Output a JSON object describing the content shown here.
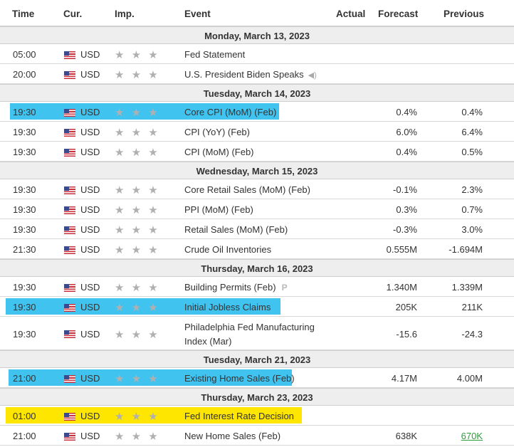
{
  "columns": {
    "time": "Time",
    "currency": "Cur.",
    "importance": "Imp.",
    "event": "Event",
    "actual": "Actual",
    "forecast": "Forecast",
    "previous": "Previous"
  },
  "colors": {
    "highlight_blue": "#41c3f0",
    "highlight_yellow": "#ffe600",
    "previous_better": "#2e9c3a"
  },
  "days": [
    {
      "label": "Monday, March 13, 2023",
      "events": [
        {
          "time": "05:00",
          "currency": "USD",
          "stars": "★ ★ ★",
          "event": "Fed Statement",
          "forecast": "",
          "previous": ""
        },
        {
          "time": "20:00",
          "currency": "USD",
          "stars": "★ ★ ★",
          "event": "U.S. President Biden Speaks",
          "forecast": "",
          "previous": "",
          "icon": "speaker-icon"
        }
      ]
    },
    {
      "label": "Tuesday, March 14, 2023",
      "events": [
        {
          "time": "19:30",
          "currency": "USD",
          "stars": "★ ★ ★",
          "event": "Core CPI (MoM) (Feb)",
          "forecast": "0.4%",
          "previous": "0.4%",
          "highlight": "blue"
        },
        {
          "time": "19:30",
          "currency": "USD",
          "stars": "★ ★ ★",
          "event": "CPI (YoY) (Feb)",
          "forecast": "6.0%",
          "previous": "6.4%"
        },
        {
          "time": "19:30",
          "currency": "USD",
          "stars": "★ ★ ★",
          "event": "CPI (MoM) (Feb)",
          "forecast": "0.4%",
          "previous": "0.5%"
        }
      ]
    },
    {
      "label": "Wednesday, March 15, 2023",
      "events": [
        {
          "time": "19:30",
          "currency": "USD",
          "stars": "★ ★ ★",
          "event": "Core Retail Sales (MoM) (Feb)",
          "forecast": "-0.1%",
          "previous": "2.3%"
        },
        {
          "time": "19:30",
          "currency": "USD",
          "stars": "★ ★ ★",
          "event": "PPI (MoM) (Feb)",
          "forecast": "0.3%",
          "previous": "0.7%"
        },
        {
          "time": "19:30",
          "currency": "USD",
          "stars": "★ ★ ★",
          "event": "Retail Sales (MoM) (Feb)",
          "forecast": "-0.3%",
          "previous": "3.0%"
        },
        {
          "time": "21:30",
          "currency": "USD",
          "stars": "★ ★ ★",
          "event": "Crude Oil Inventories",
          "forecast": "0.555M",
          "previous": "-1.694M"
        }
      ]
    },
    {
      "label": "Thursday, March 16, 2023",
      "events": [
        {
          "time": "19:30",
          "currency": "USD",
          "stars": "★ ★ ★",
          "event": "Building Permits (Feb)",
          "forecast": "1.340M",
          "previous": "1.339M",
          "badge": "P"
        },
        {
          "time": "19:30",
          "currency": "USD",
          "stars": "★ ★ ★",
          "event": "Initial Jobless Claims",
          "forecast": "205K",
          "previous": "211K",
          "highlight": "blue"
        },
        {
          "time": "19:30",
          "currency": "USD",
          "stars": "★ ★ ★",
          "event": "Philadelphia Fed Manufacturing Index (Mar)",
          "forecast": "-15.6",
          "previous": "-24.3",
          "tall": true
        }
      ]
    },
    {
      "label": "Tuesday, March 21, 2023",
      "events": [
        {
          "time": "21:00",
          "currency": "USD",
          "stars": "★ ★ ★",
          "event": "Existing Home Sales (Feb)",
          "forecast": "4.17M",
          "previous": "4.00M",
          "highlight": "blue"
        }
      ]
    },
    {
      "label": "Thursday, March 23, 2023",
      "events": [
        {
          "time": "01:00",
          "currency": "USD",
          "stars": "★ ★ ★",
          "event": "Fed Interest Rate Decision",
          "forecast": "",
          "previous": "",
          "highlight": "yellow"
        },
        {
          "time": "21:00",
          "currency": "USD",
          "stars": "★ ★ ★",
          "event": "New Home Sales (Feb)",
          "forecast": "638K",
          "previous": "670K",
          "previous_green": true
        }
      ]
    }
  ]
}
